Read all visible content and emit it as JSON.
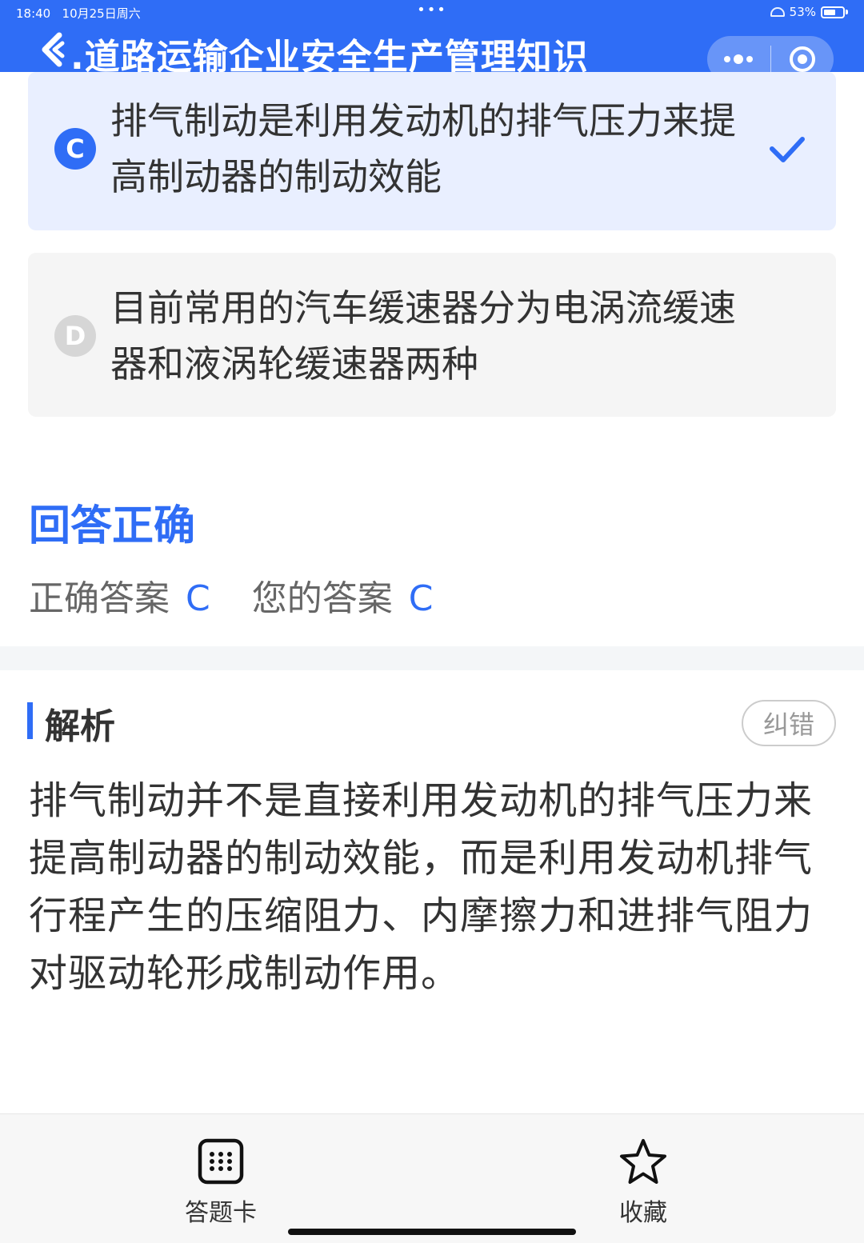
{
  "status_bar": {
    "time": "18:40",
    "date": "10月25日周六",
    "battery": "53%"
  },
  "header": {
    "title": ".道路运输企业安全生产管理知识",
    "accent_color": "#2f6df6"
  },
  "options": [
    {
      "letter": "C",
      "text": "排气制动是利用发动机的排气压力来提高制动器的制动效能",
      "selected": true
    },
    {
      "letter": "D",
      "text": "目前常用的汽车缓速器分为电涡流缓速器和液涡轮缓速器两种",
      "selected": false
    }
  ],
  "result": {
    "title": "回答正确",
    "correct_label": "正确答案",
    "correct_value": "C",
    "your_label": "您的答案",
    "your_value": "C"
  },
  "analysis": {
    "title": "解析",
    "correct_button": "纠错",
    "text": "排气制动并不是直接利用发动机的排气压力来提高制动器的制动效能，而是利用发动机排气行程产生的压缩阻力、内摩擦力和进排气阻力对驱动轮形成制动作用。"
  },
  "bottom_bar": {
    "answer_card_label": "答题卡",
    "favorite_label": "收藏",
    "answer_card_icon": "grid-icon",
    "favorite_icon": "star-icon"
  }
}
